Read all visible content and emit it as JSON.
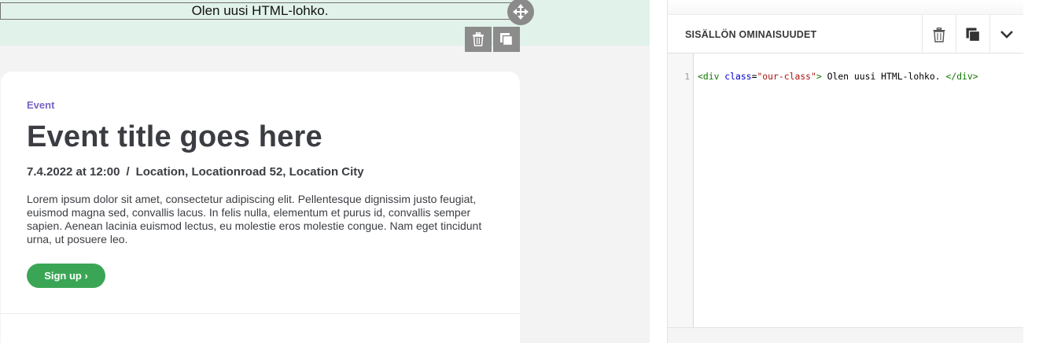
{
  "html_block": {
    "text": "Olen uusi HTML-lohko."
  },
  "block_tools": {
    "move_icon": "move-icon",
    "delete_icon": "trash-icon",
    "duplicate_icon": "duplicate-icon"
  },
  "event_card": {
    "tag": "Event",
    "title": "Event title goes here",
    "date": "7.4.2022 at 12:00",
    "separator": "/",
    "location": "Location, Locationroad 52, Location City",
    "body": "Lorem ipsum dolor sit amet, consectetur adipiscing elit. Pellentesque dignissim justo feugiat, euismod magna sed, convallis lacus. In felis nulla, elementum et purus id, convallis semper sapien. Aenean lacinia euismod lectus, eu molestie eros molestie congue. Nam eget tincidunt urna, ut posuere leo.",
    "button_label": "Sign up ›"
  },
  "properties_panel": {
    "title": "SISÄLLÖN OMINAISUUDET",
    "icons": [
      "trash-icon",
      "duplicate-icon",
      "chevron-down-icon"
    ],
    "editor": {
      "line_number": "1",
      "tokens": {
        "open_tag": "<div",
        "attr_name": "class",
        "equals": "=",
        "attr_value": "\"our-class\"",
        "close_bracket": ">",
        "content": " Olen uusi HTML-lohko. ",
        "end_tag": "</div>"
      }
    }
  },
  "colors": {
    "accent_green": "#3aa655",
    "tag_purple": "#7a63c7",
    "selected_row_bg": "#e1f2ea"
  }
}
